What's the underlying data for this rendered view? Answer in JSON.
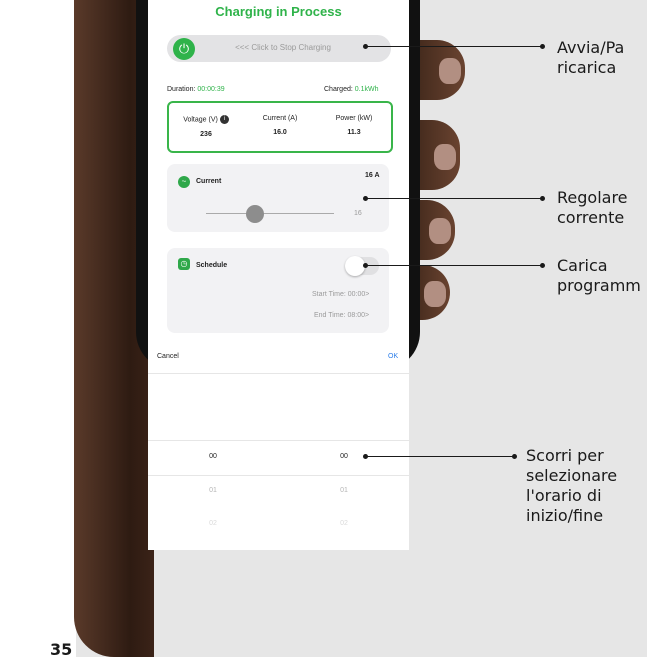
{
  "app": {
    "title": "Charging in Process",
    "stop_button_label": "<<< Click to Stop Charging",
    "duration_label": "Duration:",
    "duration_value": "00:00:39",
    "charged_label": "Charged:",
    "charged_value": "0.1kWh",
    "metrics": [
      {
        "label": "Voltage (V)",
        "value": "236"
      },
      {
        "label": "Current (A)",
        "value": "16.0"
      },
      {
        "label": "Power (kW)",
        "value": "11.3"
      }
    ],
    "current_card": {
      "label": "Current",
      "setting": "16 A",
      "slider_value_label": "16"
    },
    "schedule_card": {
      "label": "Schedule",
      "start_time": "Start Time: 00:00>",
      "end_time": "End Time: 08:00>"
    },
    "picker": {
      "cancel_label": "Cancel",
      "ok_label": "OK",
      "hours": [
        "00",
        "01",
        "02"
      ],
      "minutes": [
        "00",
        "01",
        "02"
      ]
    }
  },
  "callouts": [
    "Avvia/Pa\nricarica",
    "Regolare\ncorrente",
    "Carica\nprogramm",
    "Scorri per\nselezionare\nl'orario di\ninizio/fine"
  ],
  "page_number": "35",
  "colors": {
    "accent": "#2fb34a",
    "card_bg": "#f2f2f4",
    "panel_bg": "#e6e6e6"
  }
}
